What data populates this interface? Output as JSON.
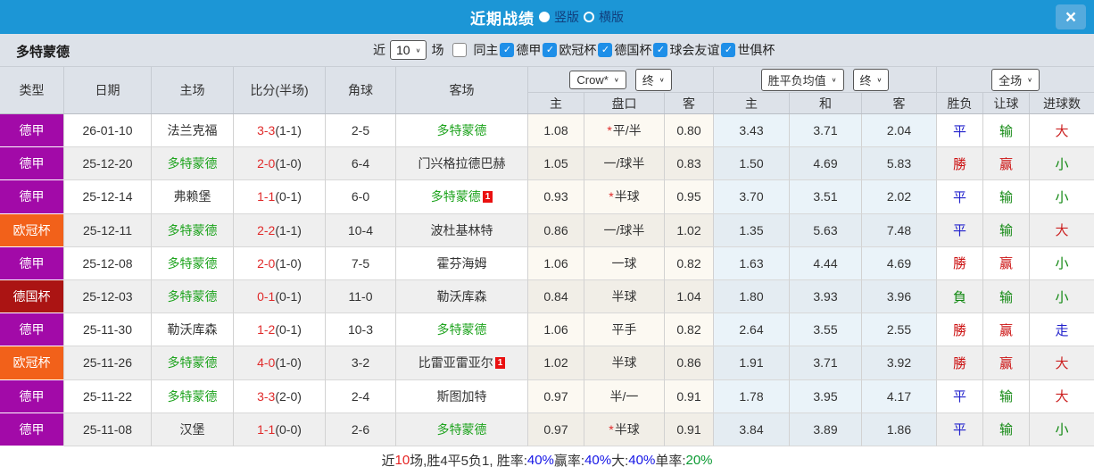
{
  "topbar": {
    "title": "近期战绩",
    "layout_options": [
      {
        "label": "竖版",
        "selected": true
      },
      {
        "label": "横版",
        "selected": false
      }
    ],
    "close_glyph": "×"
  },
  "filters": {
    "team": "多特蒙德",
    "recent_prefix": "近",
    "recent_count": "10",
    "recent_suffix": "场",
    "same_home_label": "同主",
    "same_home_checked": false,
    "competitions": [
      {
        "label": "德甲",
        "checked": true
      },
      {
        "label": "欧冠杯",
        "checked": true
      },
      {
        "label": "德国杯",
        "checked": true
      },
      {
        "label": "球会友谊",
        "checked": true
      },
      {
        "label": "世俱杯",
        "checked": true
      }
    ]
  },
  "table": {
    "dropdowns": {
      "bookmaker": "Crow*",
      "bookmaker_period": "终",
      "avg": "胜平负均值",
      "avg_period": "终",
      "scope": "全场"
    },
    "headers": {
      "type": "类型",
      "date": "日期",
      "home": "主场",
      "score": "比分(半场)",
      "corner": "角球",
      "away": "客场",
      "odds_home": "主",
      "handicap": "盘口",
      "odds_away": "客",
      "avg_home": "主",
      "avg_draw": "和",
      "avg_away": "客",
      "wdl": "胜负",
      "rang": "让球",
      "goals": "进球数"
    },
    "league_colors": {
      "德甲": "#a20aa8",
      "欧冠杯": "#f2611a",
      "德国杯": "#ab1413"
    },
    "result_colors": {
      "勝": "#cc1111",
      "平": "#2222cc",
      "負": "#118811",
      "赢": "#cc1111",
      "输": "#118811",
      "大": "#cc2222",
      "小": "#118811",
      "走": "#2222cc"
    },
    "rows": [
      {
        "type": "德甲",
        "date": "26-01-10",
        "home": {
          "name": "法兰克福",
          "green": false,
          "badge": ""
        },
        "score": "3-3",
        "half": "(1-1)",
        "corner": "2-5",
        "away": {
          "name": "多特蒙德",
          "green": true,
          "badge": ""
        },
        "crown_home": "1.08",
        "handicap_star": true,
        "handicap": "平/半",
        "crown_away": "0.80",
        "avg_home": "3.43",
        "avg_draw": "3.71",
        "avg_away": "2.04",
        "wdl": "平",
        "rang": "输",
        "goals": "大"
      },
      {
        "type": "德甲",
        "date": "25-12-20",
        "home": {
          "name": "多特蒙德",
          "green": true,
          "badge": ""
        },
        "score": "2-0",
        "half": "(1-0)",
        "corner": "6-4",
        "away": {
          "name": "门兴格拉德巴赫",
          "green": false,
          "badge": ""
        },
        "crown_home": "1.05",
        "handicap_star": false,
        "handicap": "一/球半",
        "crown_away": "0.83",
        "avg_home": "1.50",
        "avg_draw": "4.69",
        "avg_away": "5.83",
        "wdl": "勝",
        "rang": "赢",
        "goals": "小"
      },
      {
        "type": "德甲",
        "date": "25-12-14",
        "home": {
          "name": "弗赖堡",
          "green": false,
          "badge": ""
        },
        "score": "1-1",
        "half": "(0-1)",
        "corner": "6-0",
        "away": {
          "name": "多特蒙德",
          "green": true,
          "badge": "1"
        },
        "crown_home": "0.93",
        "handicap_star": true,
        "handicap": "半球",
        "crown_away": "0.95",
        "avg_home": "3.70",
        "avg_draw": "3.51",
        "avg_away": "2.02",
        "wdl": "平",
        "rang": "输",
        "goals": "小"
      },
      {
        "type": "欧冠杯",
        "date": "25-12-11",
        "home": {
          "name": "多特蒙德",
          "green": true,
          "badge": ""
        },
        "score": "2-2",
        "half": "(1-1)",
        "corner": "10-4",
        "away": {
          "name": "波杜基林特",
          "green": false,
          "badge": ""
        },
        "crown_home": "0.86",
        "handicap_star": false,
        "handicap": "一/球半",
        "crown_away": "1.02",
        "avg_home": "1.35",
        "avg_draw": "5.63",
        "avg_away": "7.48",
        "wdl": "平",
        "rang": "输",
        "goals": "大"
      },
      {
        "type": "德甲",
        "date": "25-12-08",
        "home": {
          "name": "多特蒙德",
          "green": true,
          "badge": ""
        },
        "score": "2-0",
        "half": "(1-0)",
        "corner": "7-5",
        "away": {
          "name": "霍芬海姆",
          "green": false,
          "badge": ""
        },
        "crown_home": "1.06",
        "handicap_star": false,
        "handicap": "一球",
        "crown_away": "0.82",
        "avg_home": "1.63",
        "avg_draw": "4.44",
        "avg_away": "4.69",
        "wdl": "勝",
        "rang": "赢",
        "goals": "小"
      },
      {
        "type": "德国杯",
        "date": "25-12-03",
        "home": {
          "name": "多特蒙德",
          "green": true,
          "badge": ""
        },
        "score": "0-1",
        "half": "(0-1)",
        "corner": "11-0",
        "away": {
          "name": "勒沃库森",
          "green": false,
          "badge": ""
        },
        "crown_home": "0.84",
        "handicap_star": false,
        "handicap": "半球",
        "crown_away": "1.04",
        "avg_home": "1.80",
        "avg_draw": "3.93",
        "avg_away": "3.96",
        "wdl": "負",
        "rang": "输",
        "goals": "小"
      },
      {
        "type": "德甲",
        "date": "25-11-30",
        "home": {
          "name": "勒沃库森",
          "green": false,
          "badge": ""
        },
        "score": "1-2",
        "half": "(0-1)",
        "corner": "10-3",
        "away": {
          "name": "多特蒙德",
          "green": true,
          "badge": ""
        },
        "crown_home": "1.06",
        "handicap_star": false,
        "handicap": "平手",
        "crown_away": "0.82",
        "avg_home": "2.64",
        "avg_draw": "3.55",
        "avg_away": "2.55",
        "wdl": "勝",
        "rang": "赢",
        "goals": "走"
      },
      {
        "type": "欧冠杯",
        "date": "25-11-26",
        "home": {
          "name": "多特蒙德",
          "green": true,
          "badge": ""
        },
        "score": "4-0",
        "half": "(1-0)",
        "corner": "3-2",
        "away": {
          "name": "比雷亚雷亚尔",
          "green": false,
          "badge": "1"
        },
        "crown_home": "1.02",
        "handicap_star": false,
        "handicap": "半球",
        "crown_away": "0.86",
        "avg_home": "1.91",
        "avg_draw": "3.71",
        "avg_away": "3.92",
        "wdl": "勝",
        "rang": "赢",
        "goals": "大"
      },
      {
        "type": "德甲",
        "date": "25-11-22",
        "home": {
          "name": "多特蒙德",
          "green": true,
          "badge": ""
        },
        "score": "3-3",
        "half": "(2-0)",
        "corner": "2-4",
        "away": {
          "name": "斯图加特",
          "green": false,
          "badge": ""
        },
        "crown_home": "0.97",
        "handicap_star": false,
        "handicap": "半/一",
        "crown_away": "0.91",
        "avg_home": "1.78",
        "avg_draw": "3.95",
        "avg_away": "4.17",
        "wdl": "平",
        "rang": "输",
        "goals": "大"
      },
      {
        "type": "德甲",
        "date": "25-11-08",
        "home": {
          "name": "汉堡",
          "green": false,
          "badge": ""
        },
        "score": "1-1",
        "half": "(0-0)",
        "corner": "2-6",
        "away": {
          "name": "多特蒙德",
          "green": true,
          "badge": ""
        },
        "crown_home": "0.97",
        "handicap_star": true,
        "handicap": "半球",
        "crown_away": "0.91",
        "avg_home": "3.84",
        "avg_draw": "3.89",
        "avg_away": "1.86",
        "wdl": "平",
        "rang": "输",
        "goals": "小"
      }
    ]
  },
  "footer": {
    "segments": [
      {
        "text": "近",
        "color": "#333333"
      },
      {
        "text": "10",
        "color": "#e62222"
      },
      {
        "text": "场,胜4平5负1, 胜率:",
        "color": "#333333"
      },
      {
        "text": "40%",
        "color": "#1414e6"
      },
      {
        "text": " 赢率:",
        "color": "#333333"
      },
      {
        "text": "40%",
        "color": "#1414e6"
      },
      {
        "text": " 大:",
        "color": "#333333"
      },
      {
        "text": "40%",
        "color": "#1414e6"
      },
      {
        "text": " 单率:",
        "color": "#333333"
      },
      {
        "text": "20%",
        "color": "#0a9a32"
      }
    ]
  },
  "colors": {
    "topbar_blue": "#1c96d6",
    "close_button_blue": "#54aadd",
    "checkbox_blue": "#1e8fe8",
    "bar_gray": "#dde2e9",
    "highlight_team_green": "#1da31d",
    "score_red": "#e02a2a"
  }
}
